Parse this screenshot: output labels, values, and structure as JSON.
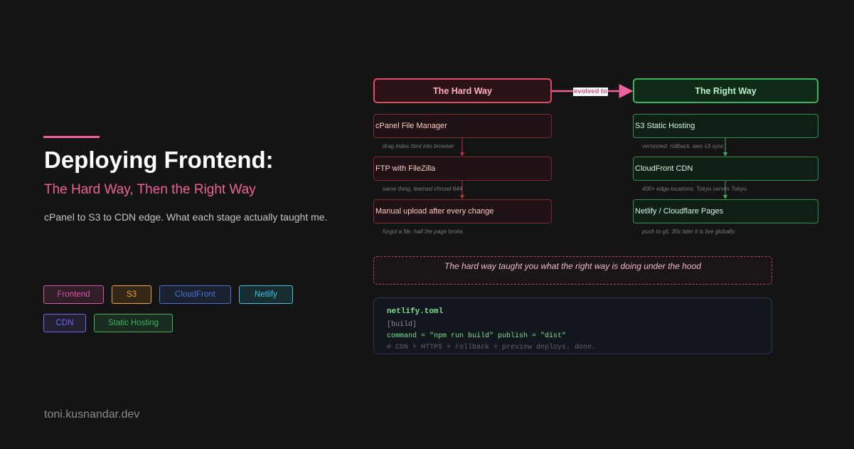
{
  "intro": {
    "title": "Deploying Frontend:",
    "subtitle": "The Hard Way, Then the Right Way",
    "description": "cPanel to S3 to CDN edge. What each stage actually taught me."
  },
  "tags": [
    {
      "label": "Frontend",
      "color": "#e055a5"
    },
    {
      "label": "S3",
      "color": "#f0a030"
    },
    {
      "label": "CloudFront",
      "color": "#4a74d8"
    },
    {
      "label": "Netlify",
      "color": "#35c4e0"
    },
    {
      "label": "CDN",
      "color": "#7468e8"
    },
    {
      "label": "Static Hosting",
      "color": "#3bb45e"
    }
  ],
  "footer": "toni.kusnandar.dev",
  "diagram": {
    "hard_way": {
      "title": "The Hard Way",
      "color": "#e04a66",
      "steps": [
        {
          "label": "cPanel File Manager",
          "note": "drag index.html into browser"
        },
        {
          "label": "FTP with FileZilla",
          "note": "same thing, learned chmod 644"
        },
        {
          "label": "Manual upload after every change",
          "note": "forgot a file. half the page broke."
        }
      ]
    },
    "right_way": {
      "title": "The Right Way",
      "color": "#3bb45e",
      "steps": [
        {
          "label": "S3 Static Hosting",
          "note": "versioned. rollback. aws s3 sync ."
        },
        {
          "label": "CloudFront CDN",
          "note": "400+ edge locations. Tokyo serves Tokyo."
        },
        {
          "label": "Netlify / Cloudflare Pages",
          "note": "push to git. 30s later it is live globally."
        }
      ]
    },
    "connector_label": "evolved to",
    "connector_color": "#f0609a",
    "callout": "The hard way taught you what the right way is doing under the hood",
    "code": {
      "filename": "netlify.toml",
      "lines": [
        "[build]",
        "command = \"npm run build\" publish = \"dist\"",
        "# CDN + HTTPS + rollback + preview deploys. done."
      ]
    }
  }
}
